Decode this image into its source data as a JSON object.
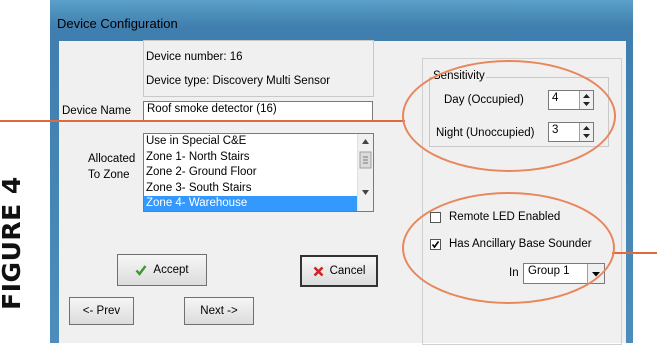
{
  "figure_label": "FIGURE 4",
  "window": {
    "title": "Device Configuration"
  },
  "info": {
    "device_number": "Device number: 16",
    "device_type": "Device type: Discovery Multi Sensor"
  },
  "device_name": {
    "label": "Device Name",
    "value": "Roof smoke detector (16)"
  },
  "zone": {
    "label_line1": "Allocated",
    "label_line2": "To Zone",
    "items": [
      {
        "label": "Use in Special C&E"
      },
      {
        "label": "Zone 1- North Stairs"
      },
      {
        "label": "Zone 2- Ground Floor"
      },
      {
        "label": "Zone 3- South Stairs"
      },
      {
        "label": "Zone 4- Warehouse"
      }
    ],
    "selected": "Zone 4- Warehouse"
  },
  "sensitivity": {
    "legend": "Sensitivity",
    "day_label": "Day (Occupied)",
    "day_value": "4",
    "night_label": "Night (Unoccupied)",
    "night_value": "3"
  },
  "options": {
    "remote_led_label": "Remote LED Enabled",
    "remote_led_checked": false,
    "ancillary_label": "Has Ancillary Base Sounder",
    "ancillary_checked": true,
    "in_label": "In",
    "group_value": "Group 1"
  },
  "buttons": {
    "accept": "Accept",
    "cancel": "Cancel",
    "prev": "<- Prev",
    "next": "Next ->"
  },
  "colors": {
    "highlight_ellipse": "#e8865c",
    "leader_line": "#e06a3c",
    "accept_icon": "#3a9a2c",
    "cancel_icon": "#d42020",
    "selection": "#3399ff"
  }
}
